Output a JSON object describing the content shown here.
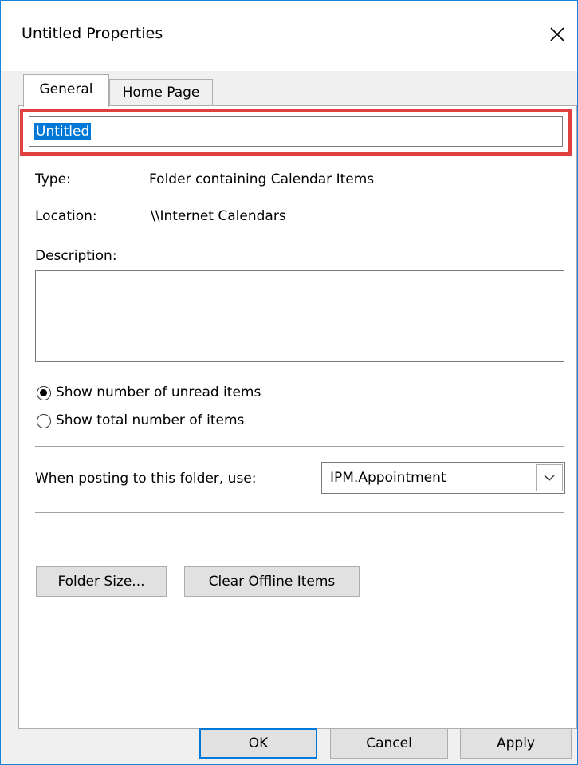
{
  "window": {
    "title": "Untitled Properties"
  },
  "tabs": [
    {
      "label": "General",
      "active": true
    },
    {
      "label": "Home Page",
      "active": false
    }
  ],
  "general": {
    "name_value": "Untitled",
    "type_label": "Type:",
    "type_value": "Folder containing Calendar Items",
    "location_label": "Location:",
    "location_value": "\\\\Internet Calendars",
    "description_label": "Description:",
    "description_value": "",
    "radio_unread": {
      "label": "Show number of unread items",
      "checked": true
    },
    "radio_total": {
      "label": "Show total number of items",
      "checked": false
    },
    "posting_label": "When posting to this folder, use:",
    "posting_value": "IPM.Appointment",
    "folder_size_button": "Folder Size...",
    "clear_offline_button": "Clear Offline Items"
  },
  "footer": {
    "ok": "OK",
    "cancel": "Cancel",
    "apply": "Apply"
  },
  "colors": {
    "accent": "#0078d7",
    "highlight_border": "#e04040",
    "window_border": "#1883d7"
  }
}
